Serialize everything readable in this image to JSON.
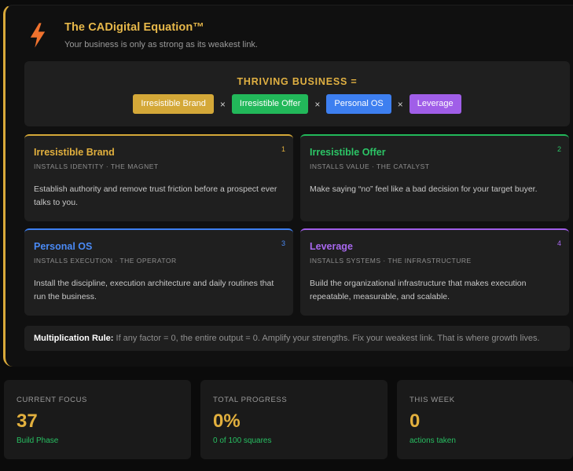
{
  "header": {
    "icon": "lightning-bolt-icon",
    "title": "The CADigital Equation™",
    "subtitle": "Your business is only as strong as its weakest link."
  },
  "equation": {
    "title": "THRIVING BUSINESS =",
    "operator": "×",
    "factors": [
      {
        "label": "Irresistible Brand",
        "color": "#d4a838"
      },
      {
        "label": "Irresistible Offer",
        "color": "#22b85a"
      },
      {
        "label": "Personal OS",
        "color": "#3d7ff0"
      },
      {
        "label": "Leverage",
        "color": "#a05ee8"
      }
    ]
  },
  "cards": [
    {
      "num": "1",
      "name": "Irresistible Brand",
      "tag": "INSTALLS IDENTITY · THE MAGNET",
      "desc": "Establish authority and remove trust friction before a prospect ever talks to you.",
      "color": "#d4a838"
    },
    {
      "num": "2",
      "name": "Irresistible Offer",
      "tag": "INSTALLS VALUE · THE CATALYST",
      "desc": "Make saying “no” feel like a bad decision for your target buyer.",
      "color": "#22b85a"
    },
    {
      "num": "3",
      "name": "Personal OS",
      "tag": "INSTALLS EXECUTION · THE OPERATOR",
      "desc": "Install the discipline, execution architecture and daily routines that run the business.",
      "color": "#3d7ff0"
    },
    {
      "num": "4",
      "name": "Leverage",
      "tag": "INSTALLS SYSTEMS · THE INFRASTRUCTURE",
      "desc": "Build the organizational infrastructure that makes execution repeatable, measurable, and scalable.",
      "color": "#a05ee8"
    }
  ],
  "rule": {
    "label": "Multiplication Rule:",
    "text": "If any factor = 0, the entire output = 0. Amplify your strengths. Fix your weakest link. That is where growth lives."
  },
  "stats": [
    {
      "label": "CURRENT FOCUS",
      "value": "37",
      "sub": "Build Phase"
    },
    {
      "label": "TOTAL PROGRESS",
      "value": "0%",
      "sub": "0 of 100 squares"
    },
    {
      "label": "THIS WEEK",
      "value": "0",
      "sub": "actions taken"
    }
  ]
}
